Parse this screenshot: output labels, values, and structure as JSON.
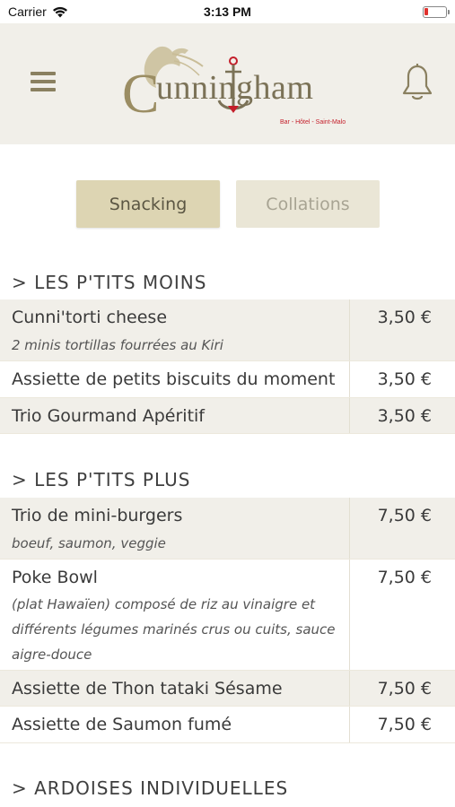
{
  "status_bar": {
    "carrier": "Carrier",
    "time": "3:13 PM"
  },
  "header": {
    "logo_text": "unningham",
    "logo_initial": "C",
    "logo_subtitle": "Bar - Hôtel - Saint-Malo",
    "icons": [
      "hamburger-menu-icon",
      "bell-icon"
    ]
  },
  "tabs": [
    {
      "label": "Snacking",
      "active": true
    },
    {
      "label": "Collations",
      "active": false
    }
  ],
  "sections": [
    {
      "title": "> LES P'TITS MOINS",
      "items": [
        {
          "name": "Cunni'torti cheese",
          "desc": [
            "2 minis tortillas fourrées au Kiri"
          ],
          "price": "3,50 €"
        },
        {
          "name": "Assiette de petits biscuits du moment",
          "desc": [],
          "price": "3,50 €"
        },
        {
          "name": "Trio Gourmand Apéritif",
          "desc": [],
          "price": "3,50 €"
        }
      ]
    },
    {
      "title": "> LES P'TITS PLUS",
      "items": [
        {
          "name": "Trio de mini-burgers",
          "desc": [
            "boeuf, saumon, veggie"
          ],
          "price": "7,50 €"
        },
        {
          "name": "Poke Bowl",
          "desc": [
            "(plat Hawaïen) composé de riz au vinaigre et",
            "différents légumes marinés crus ou cuits, sauce",
            "aigre-douce"
          ],
          "price": "7,50 €"
        },
        {
          "name": "Assiette de Thon tataki Sésame",
          "desc": [],
          "price": "7,50 €"
        },
        {
          "name": "Assiette de Saumon fumé",
          "desc": [],
          "price": "7,50 €"
        }
      ]
    },
    {
      "title": "> ARDOISES INDIVIDUELLES",
      "items": []
    }
  ]
}
